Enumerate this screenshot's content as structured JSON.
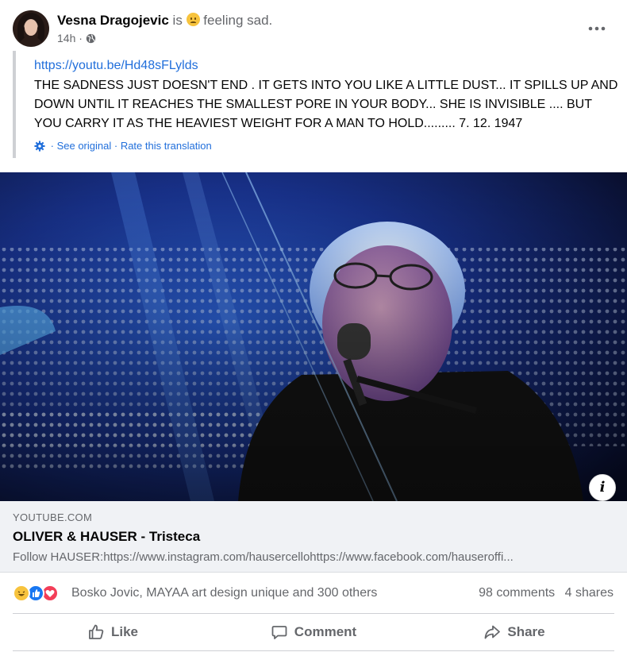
{
  "post": {
    "author": "Vesna Dragojevic",
    "is_text": "is",
    "feeling": "feeling sad.",
    "time": "14h",
    "separator": "·",
    "link": "https://youtu.be/Hd48sFLylds",
    "text": "THE SADNESS JUST DOESN'T END . IT GETS INTO YOU LIKE A LITTLE DUST... IT SPILLS UP AND DOWN UNTIL IT REACHES THE SMALLEST PORE IN YOUR BODY... SHE IS INVISIBLE .... BUT YOU CARRY IT AS THE HEAVIEST WEIGHT FOR A MAN TO HOLD......... 7. 12. 1947",
    "see_original": "See original",
    "rate_translation": "Rate this translation"
  },
  "link_card": {
    "domain": "YOUTUBE.COM",
    "title": "OLIVER & HAUSER - Tristeca",
    "description": "Follow HAUSER:https://www.instagram.com/hausercellohttps://www.facebook.com/hauseroffi..."
  },
  "reactions": {
    "names": "Bosko Jovic, MAYAA art design unique and 300 others",
    "comments": "98 comments",
    "shares": "4 shares"
  },
  "actions": {
    "like": "Like",
    "comment": "Comment",
    "share": "Share"
  },
  "icons": [
    "more-icon",
    "globe-icon",
    "gear-icon",
    "info-icon",
    "haha-reaction-icon",
    "like-reaction-icon",
    "love-reaction-icon",
    "like-icon",
    "comment-icon",
    "share-icon"
  ],
  "colors": {
    "link": "#216fdb",
    "secondary_text": "#65676b",
    "card_bg": "#f0f2f5",
    "like_blue": "#1877f2",
    "love_red": "#f33e58"
  }
}
